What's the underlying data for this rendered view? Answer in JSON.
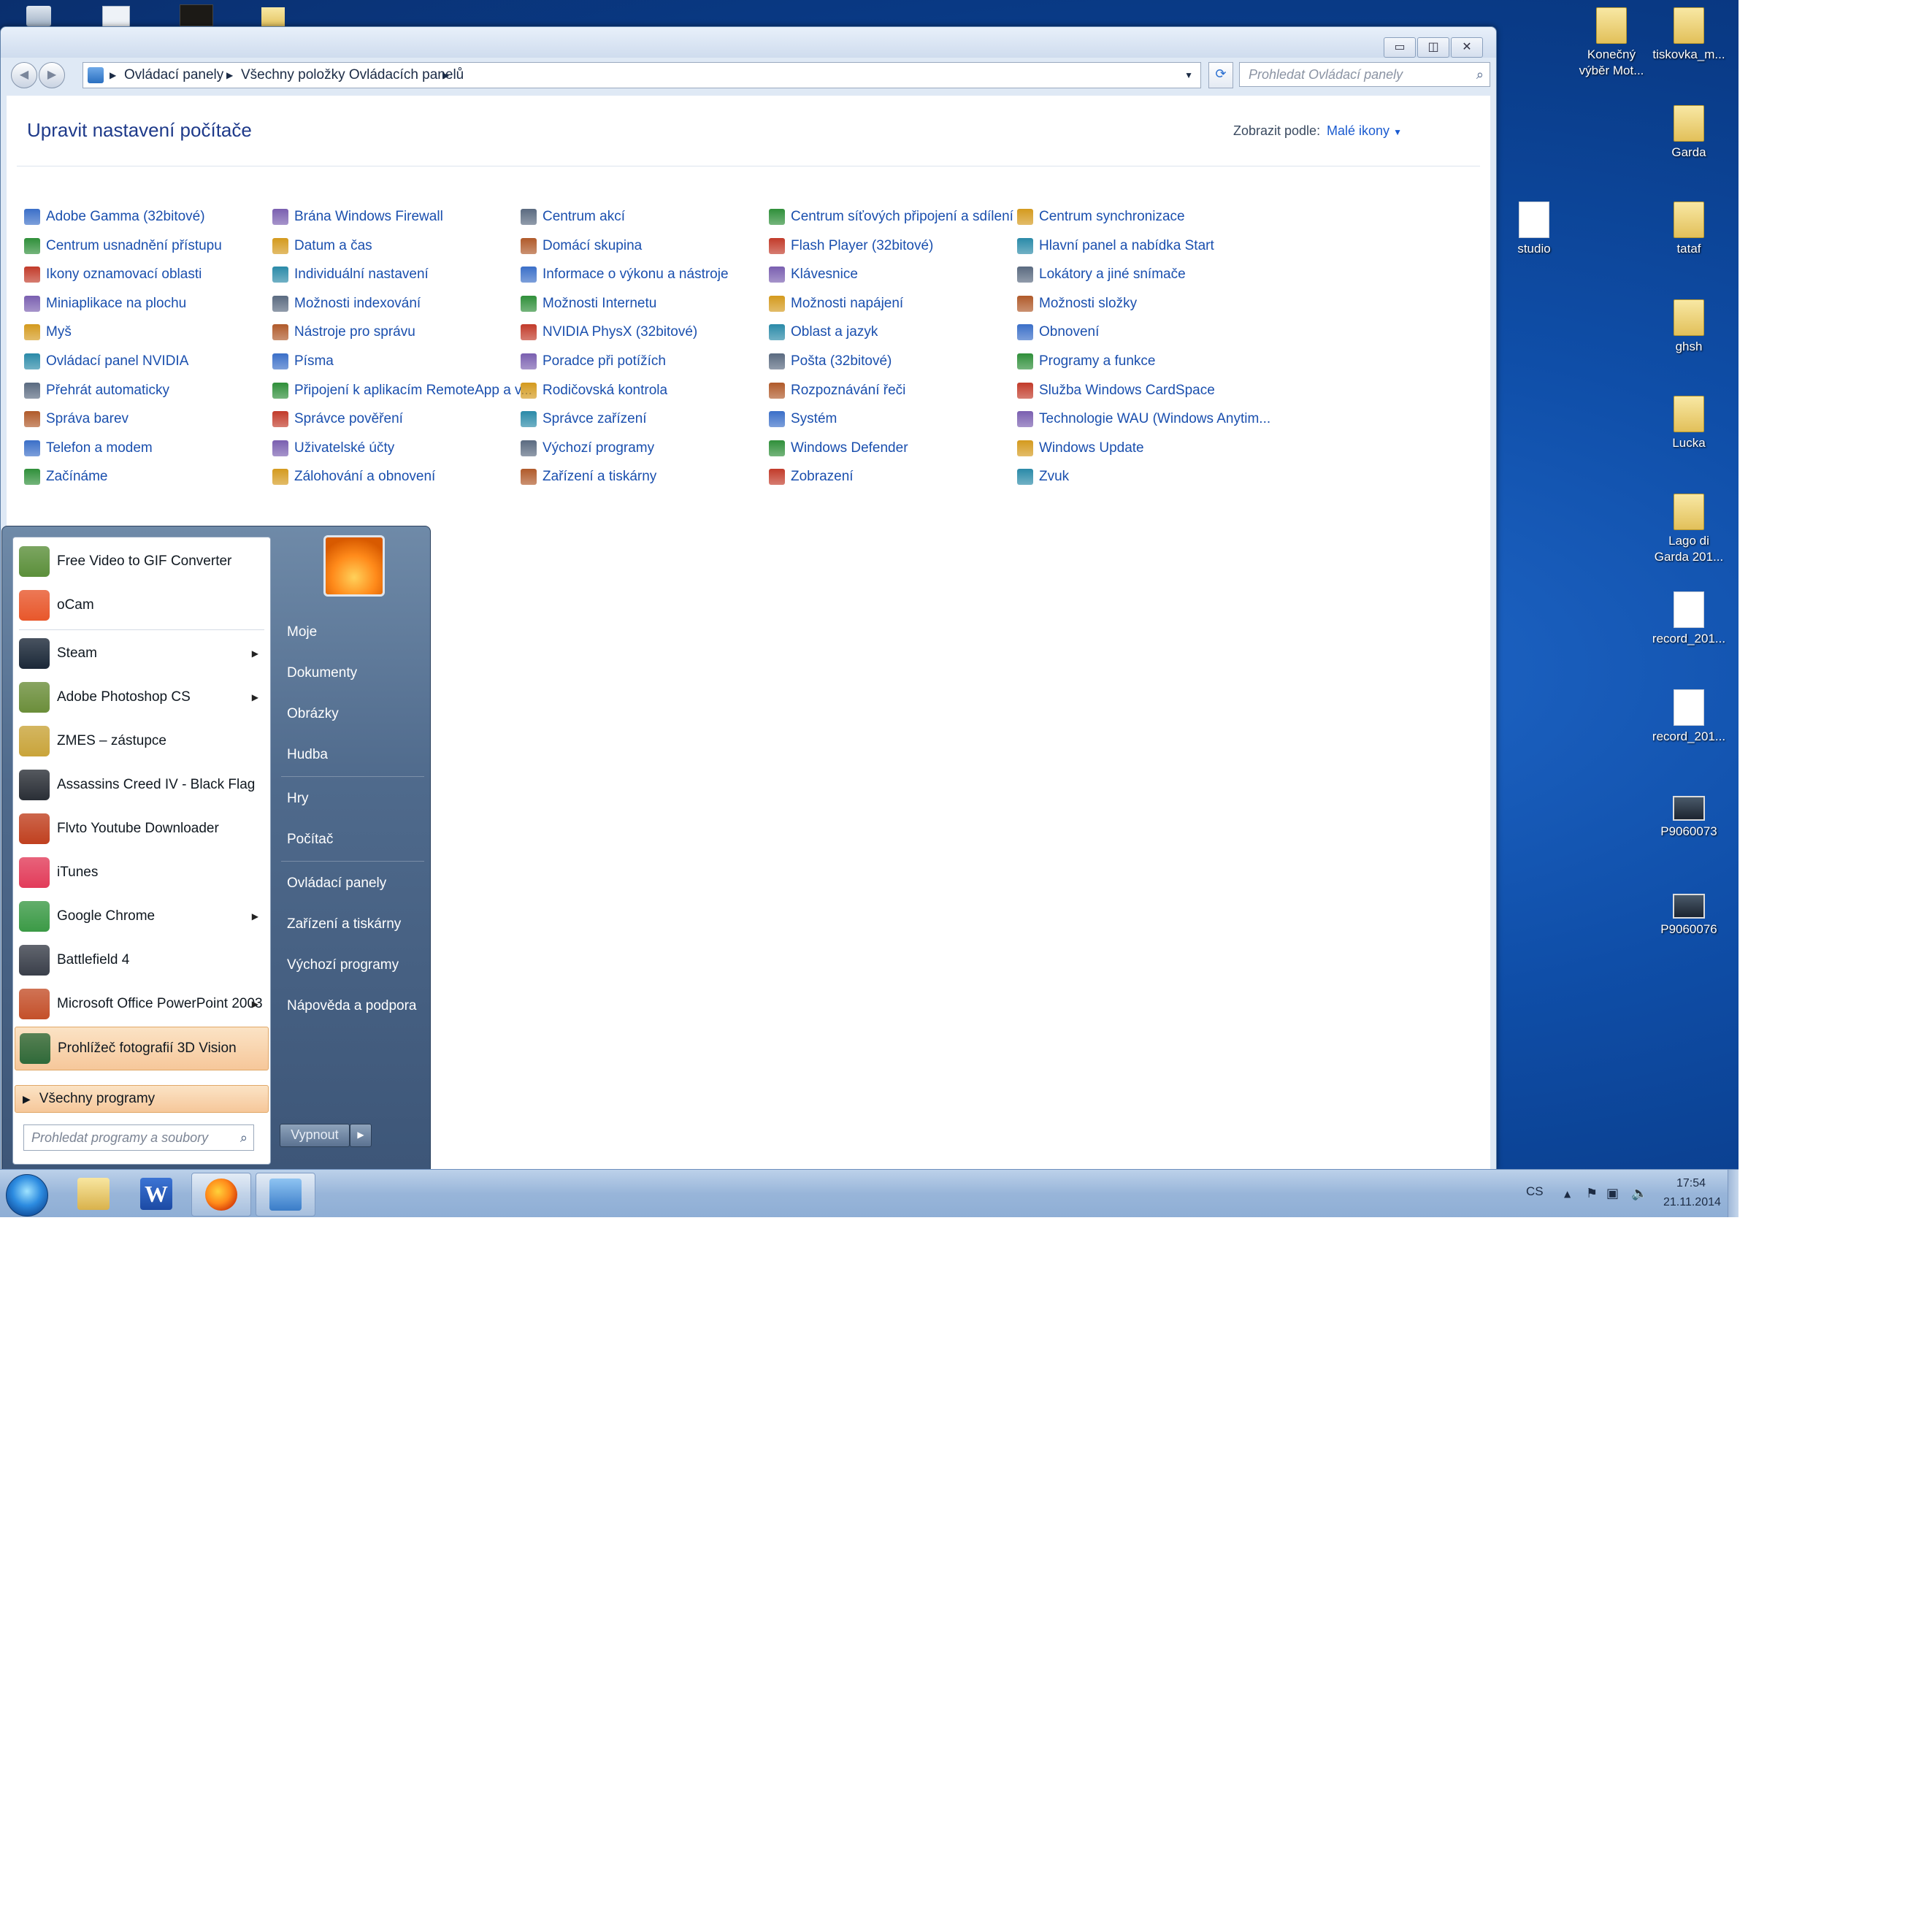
{
  "window": {
    "breadcrumb": [
      "Ovládací panely",
      "Všechny položky Ovládacích panelů"
    ],
    "search_placeholder": "Prohledat Ovládací panely",
    "page_title": "Upravit nastavení počítače",
    "view_by_label": "Zobrazit podle:",
    "view_by_value": "Malé ikony",
    "columns": [
      [
        "Adobe Gamma (32bitové)",
        "Centrum usnadnění přístupu",
        "Ikony oznamovací oblasti",
        "Miniaplikace na plochu",
        "Myš",
        "Ovládací panel NVIDIA",
        "Přehrát automaticky",
        "Správa barev",
        "Telefon a modem",
        "Začínáme"
      ],
      [
        "Brána Windows Firewall",
        "Datum a čas",
        "Individuální nastavení",
        "Možnosti indexování",
        "Nástroje pro správu",
        "Písma",
        "Připojení k aplikacím RemoteApp a v...",
        "Správce pověření",
        "Uživatelské účty",
        "Zálohování a obnovení"
      ],
      [
        "Centrum akcí",
        "Domácí skupina",
        "Informace o výkonu a nástroje",
        "Možnosti Internetu",
        "NVIDIA PhysX (32bitové)",
        "Poradce při potížích",
        "Rodičovská kontrola",
        "Správce zařízení",
        "Výchozí programy",
        "Zařízení a tiskárny"
      ],
      [
        "Centrum síťových připojení a sdílení",
        "Flash Player (32bitové)",
        "Klávesnice",
        "Možnosti napájení",
        "Oblast a jazyk",
        "Pošta (32bitové)",
        "Rozpoznávání řeči",
        "Systém",
        "Windows Defender",
        "Zobrazení"
      ],
      [
        "Centrum synchronizace",
        "Hlavní panel a nabídka Start",
        "Lokátory a jiné snímače",
        "Možnosti složky",
        "Obnovení",
        "Programy a funkce",
        "Služba Windows CardSpace",
        "Technologie WAU (Windows Anytim...",
        "Windows Update",
        "Zvuk"
      ]
    ]
  },
  "desktop_icons": [
    {
      "label1": "Konečný",
      "label2": "výběr Mot...",
      "kind": "folder"
    },
    {
      "label1": "tiskovka_m...",
      "label2": "",
      "kind": "folder"
    },
    {
      "label1": "Garda",
      "label2": "",
      "kind": "folder"
    },
    {
      "label1": "studio",
      "label2": "",
      "kind": "doc"
    },
    {
      "label1": "tataf",
      "label2": "",
      "kind": "folder"
    },
    {
      "label1": "ghsh",
      "label2": "",
      "kind": "folder"
    },
    {
      "label1": "Lucka",
      "label2": "",
      "kind": "folder"
    },
    {
      "label1": "Lago di",
      "label2": "Garda 201...",
      "kind": "folder"
    },
    {
      "label1": "record_201...",
      "label2": "",
      "kind": "doc"
    },
    {
      "label1": "record_201...",
      "label2": "",
      "kind": "doc"
    },
    {
      "label1": "P9060073",
      "label2": "",
      "kind": "photo"
    },
    {
      "label1": "P9060076",
      "label2": "",
      "kind": "photo"
    }
  ],
  "start_menu": {
    "programs": [
      {
        "label": "Free Video to GIF Converter",
        "submenu": false,
        "highlight": false,
        "color": "#5b8f3a"
      },
      {
        "label": "oCam",
        "submenu": false,
        "highlight": false,
        "color": "#e8572b"
      },
      {
        "label": "Steam",
        "submenu": true,
        "highlight": false,
        "color": "#1b2838"
      },
      {
        "label": "Adobe Photoshop CS",
        "submenu": true,
        "highlight": false,
        "color": "#6b8e3a"
      },
      {
        "label": "ZMES – zástupce",
        "submenu": false,
        "highlight": false,
        "color": "#c9a43a"
      },
      {
        "label": "Assassins Creed IV - Black Flag",
        "submenu": false,
        "highlight": false,
        "color": "#2a2f36"
      },
      {
        "label": "Flvto Youtube Downloader",
        "submenu": false,
        "highlight": false,
        "color": "#c0401f"
      },
      {
        "label": "iTunes",
        "submenu": false,
        "highlight": false,
        "color": "#e23c5a"
      },
      {
        "label": "Google Chrome",
        "submenu": true,
        "highlight": false,
        "color": "#3b9a46"
      },
      {
        "label": "Battlefield 4",
        "submenu": false,
        "highlight": false,
        "color": "#3a3f4a"
      },
      {
        "label": "Microsoft Office PowerPoint 2003",
        "submenu": true,
        "highlight": false,
        "color": "#c4502a"
      },
      {
        "label": "Prohlížeč fotografií 3D Vision",
        "submenu": false,
        "highlight": true,
        "color": "#2f6a3a"
      }
    ],
    "all_programs": "Všechny programy",
    "search_placeholder": "Prohledat programy a soubory",
    "right_items": [
      "Moje",
      "Dokumenty",
      "Obrázky",
      "Hudba",
      "Hry",
      "Počítač",
      "Ovládací panely",
      "Zařízení a tiskárny",
      "Výchozí programy",
      "Nápověda a podpora"
    ],
    "shutdown": "Vypnout"
  },
  "taskbar": {
    "language": "CS",
    "time": "17:54",
    "date": "21.11.2014"
  }
}
